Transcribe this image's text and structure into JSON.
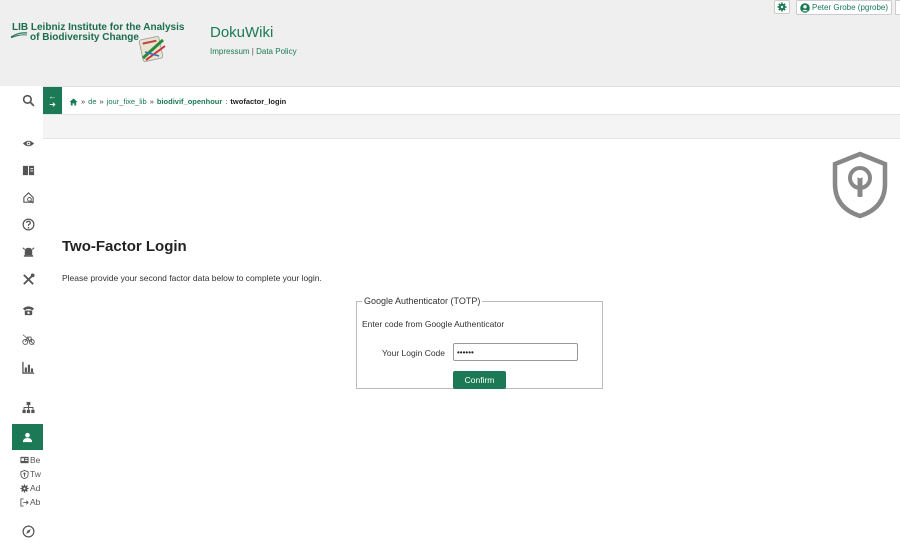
{
  "header": {
    "logo_line1": "LIB Leibniz Institute for the Analysis",
    "logo_line2": "of Biodiversity Change",
    "wiki_title": "DokuWiki",
    "impressum": "Impressum",
    "separator": "|",
    "data_policy": "Data Policy",
    "user_label": "Peter Grobe (pgrobe)"
  },
  "sidebar": {
    "icons": [
      "search-icon",
      "eye-icon",
      "book-icon",
      "home-search-icon",
      "help-icon",
      "alarm-icon",
      "tools-icon",
      "phone-icon",
      "bike-icon",
      "chart-icon",
      "sitemap-icon",
      "user-icon",
      "compass-icon"
    ],
    "submenu": [
      {
        "icon": "card-icon",
        "label": "Be"
      },
      {
        "icon": "shield-key-icon",
        "label": "Tw"
      },
      {
        "icon": "gear-icon",
        "label": "Ad"
      },
      {
        "icon": "logout-icon",
        "label": "Ab"
      }
    ]
  },
  "breadcrumbs": {
    "sep": "»",
    "items": [
      "de",
      "jour_fixe_lib",
      "biodivif_openhour"
    ],
    "current_sep": ":",
    "current": "twofactor_login"
  },
  "page": {
    "title": "Two-Factor Login",
    "intro": "Please provide your second factor data below to complete your login."
  },
  "form": {
    "legend": "Google Authenticator (TOTP)",
    "description": "Enter code from Google Authenticator",
    "code_label": "Your Login Code",
    "code_value": "••••••",
    "confirm_label": "Confirm"
  },
  "colors": {
    "accent": "#1b7a55",
    "header_bg": "#efefef"
  }
}
